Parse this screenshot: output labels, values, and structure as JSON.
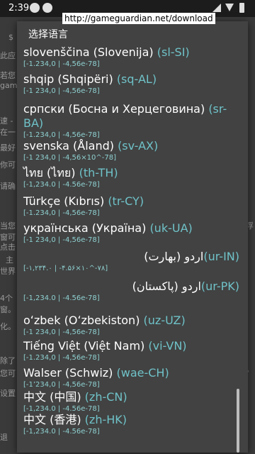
{
  "status": {
    "time": "2:39"
  },
  "url": "http://gameguardian.net/download",
  "dialog_title": "选择语言",
  "items": [
    {
      "name": "slovenščina (Slovenija) ",
      "code": "(sl-SI)",
      "fmt": "[-1.234,0 | -4,56e-78]",
      "rtl": false
    },
    {
      "name": "shqip (Shqipëri) ",
      "code": "(sq-AL)",
      "fmt": "[-1 234,0 | -4,56e-78]",
      "rtl": false
    },
    {
      "name": "српски (Босна и Херцеговина) ",
      "code": "(sr-BA)",
      "fmt": "[-1.234,0 | -4,56e-78]",
      "rtl": false
    },
    {
      "name": "svenska (Åland) ",
      "code": "(sv-AX)",
      "fmt": "[-1 234,0 | -4,56×10^-78]",
      "rtl": false
    },
    {
      "name": "ไทย (ไทย) ",
      "code": "(th-TH)",
      "fmt": "[-1,234.0 | -4.56e-78]",
      "rtl": false
    },
    {
      "name": "Türkçe (Kıbrıs) ",
      "code": "(tr-CY)",
      "fmt": "[-1.234,0 | -4,56e-78]",
      "rtl": false
    },
    {
      "name": "українська (Україна) ",
      "code": "(uk-UA)",
      "fmt": "[-1 234,0 | -4,56e-78]",
      "rtl": false
    },
    {
      "name": "اردو (بھارت) ",
      "code": "(ur-IN)",
      "fmt": "[-۱,۲۳۴.۰ | -۴.۵۶×۱۰^-۷۸]",
      "rtl": true
    },
    {
      "name": "اردو (پاکستان) ",
      "code": "(ur-PK)",
      "fmt": "[-1,234.0 | -4.56e-78]",
      "rtl": true
    },
    {
      "name": "oʻzbek (Oʻzbekiston) ",
      "code": "(uz-UZ)",
      "fmt": "[-1 234,0 | -4,56e-78]",
      "rtl": false
    },
    {
      "name": "Tiếng Việt (Việt Nam) ",
      "code": "(vi-VN)",
      "fmt": "[-1.234,0 | -4,56e-78]",
      "rtl": false
    },
    {
      "name": "Walser (Schwiz) ",
      "code": "(wae-CH)",
      "fmt": "[-1’234,0 | -4,56e-78]",
      "rtl": false
    },
    {
      "name": "中文 (中国) ",
      "code": "(zh-CN)",
      "fmt": "[-1,234.0 | -4.56e-78]",
      "rtl": false
    },
    {
      "name": "中文 (香港) ",
      "code": "(zh-HK)",
      "fmt": "[-1,234.0 | -4.56e-78]",
      "rtl": false
    }
  ],
  "background": {
    "labels": [
      "$",
      "此应",
      "若您",
      "gam",
      "加",
      "速 -",
      "在一",
      "最好",
      "你可",
      "请确",
      "当您",
      "窗可",
      "点击",
      "择浮",
      "主",
      "世界",
      "4个",
      "窗。",
      "化。",
      "除了",
      "您可",
      "作。",
      "设置",
      "复",
      "退"
    ]
  }
}
